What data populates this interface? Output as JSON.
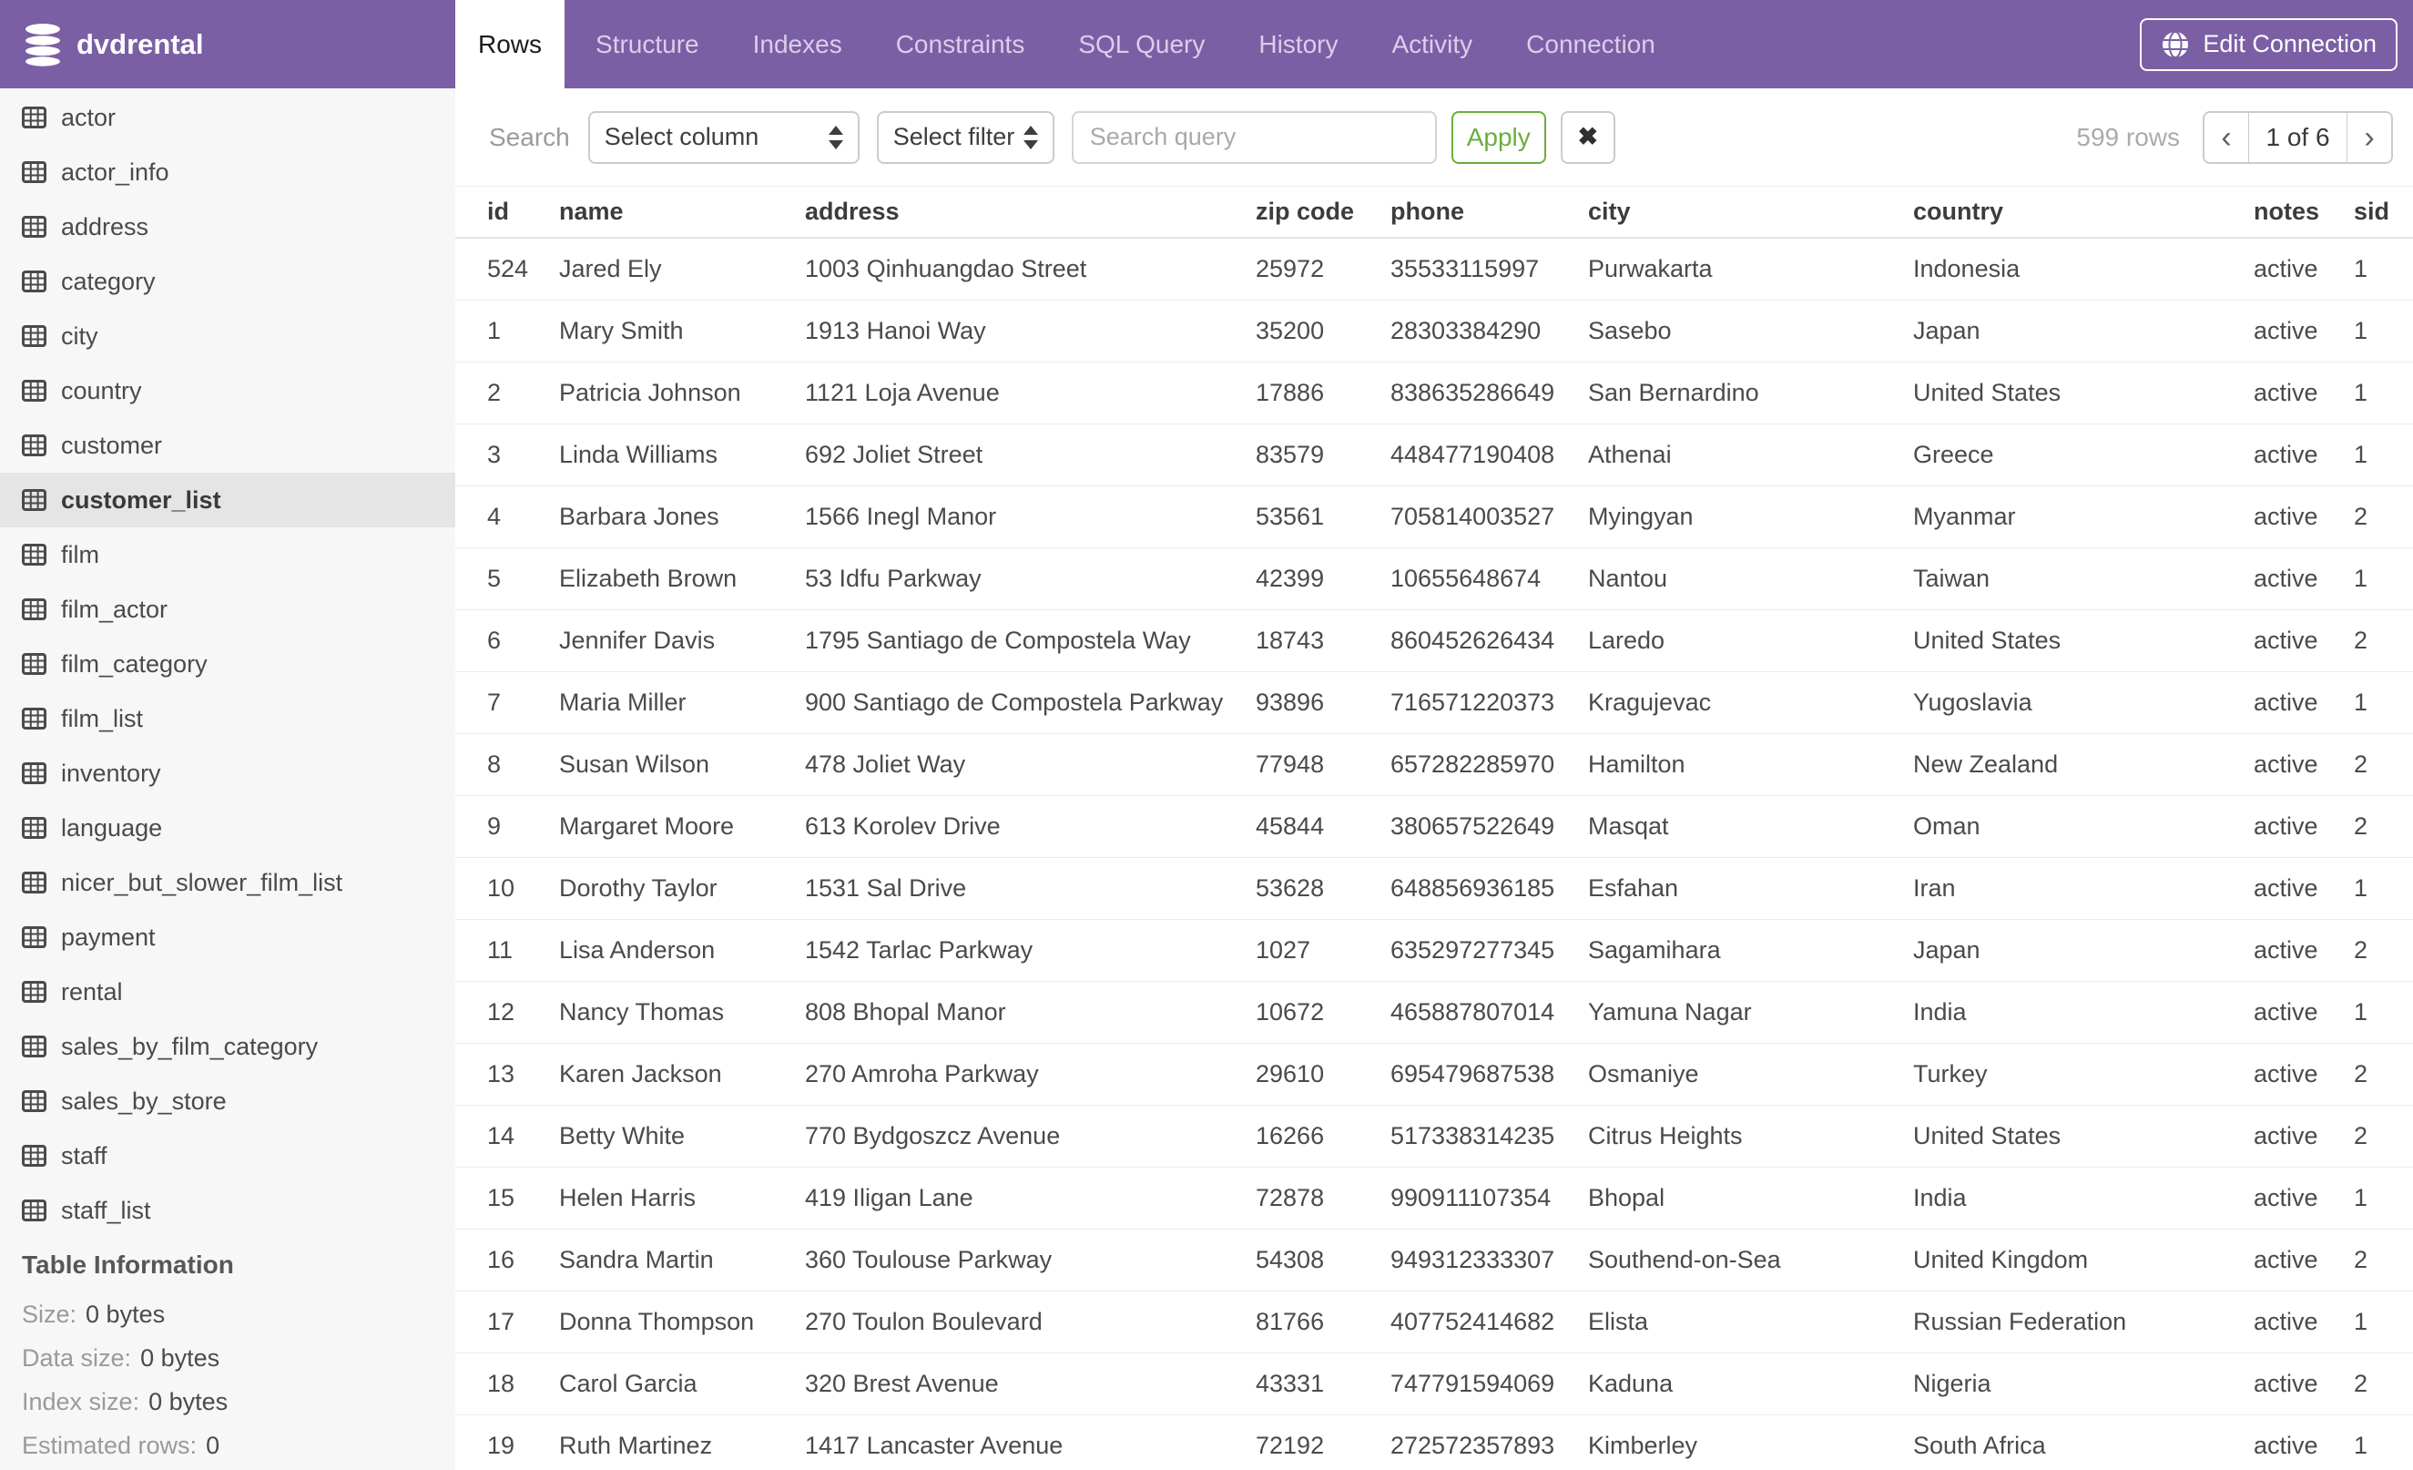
{
  "header": {
    "database_name": "dvdrental",
    "tabs": [
      {
        "label": "Rows",
        "active": true
      },
      {
        "label": "Structure"
      },
      {
        "label": "Indexes"
      },
      {
        "label": "Constraints"
      },
      {
        "label": "SQL Query"
      },
      {
        "label": "History"
      },
      {
        "label": "Activity"
      },
      {
        "label": "Connection"
      }
    ],
    "edit_connection_label": "Edit Connection"
  },
  "sidebar": {
    "tables": [
      {
        "label": "actor"
      },
      {
        "label": "actor_info"
      },
      {
        "label": "address"
      },
      {
        "label": "category"
      },
      {
        "label": "city"
      },
      {
        "label": "country"
      },
      {
        "label": "customer"
      },
      {
        "label": "customer_list",
        "active": true
      },
      {
        "label": "film"
      },
      {
        "label": "film_actor"
      },
      {
        "label": "film_category"
      },
      {
        "label": "film_list"
      },
      {
        "label": "inventory"
      },
      {
        "label": "language"
      },
      {
        "label": "nicer_but_slower_film_list"
      },
      {
        "label": "payment"
      },
      {
        "label": "rental"
      },
      {
        "label": "sales_by_film_category"
      },
      {
        "label": "sales_by_store"
      },
      {
        "label": "staff"
      },
      {
        "label": "staff_list"
      }
    ],
    "table_information": {
      "title": "Table Information",
      "fields": [
        {
          "label": "Size:",
          "value": "0 bytes"
        },
        {
          "label": "Data size:",
          "value": "0 bytes"
        },
        {
          "label": "Index size:",
          "value": "0 bytes"
        },
        {
          "label": "Estimated rows:",
          "value": "0"
        }
      ]
    }
  },
  "toolbar": {
    "search_label": "Search",
    "column_select_value": "Select column",
    "filter_select_value": "Select filter",
    "query_placeholder": "Search query",
    "apply_label": "Apply",
    "clear_icon": "✖",
    "rows_count": "599 rows",
    "pagination": {
      "prev": "‹",
      "current": "1 of 6",
      "next": "›"
    }
  },
  "table": {
    "columns": [
      "id",
      "name",
      "address",
      "zip code",
      "phone",
      "city",
      "country",
      "notes",
      "sid"
    ],
    "rows": [
      {
        "id": "524",
        "name": "Jared Ely",
        "address": "1003 Qinhuangdao Street",
        "zip": "25972",
        "phone": "35533115997",
        "city": "Purwakarta",
        "country": "Indonesia",
        "notes": "active",
        "sid": "1"
      },
      {
        "id": "1",
        "name": "Mary Smith",
        "address": "1913 Hanoi Way",
        "zip": "35200",
        "phone": "28303384290",
        "city": "Sasebo",
        "country": "Japan",
        "notes": "active",
        "sid": "1"
      },
      {
        "id": "2",
        "name": "Patricia Johnson",
        "address": "1121 Loja Avenue",
        "zip": "17886",
        "phone": "838635286649",
        "city": "San Bernardino",
        "country": "United States",
        "notes": "active",
        "sid": "1"
      },
      {
        "id": "3",
        "name": "Linda Williams",
        "address": "692 Joliet Street",
        "zip": "83579",
        "phone": "448477190408",
        "city": "Athenai",
        "country": "Greece",
        "notes": "active",
        "sid": "1"
      },
      {
        "id": "4",
        "name": "Barbara Jones",
        "address": "1566 Inegl Manor",
        "zip": "53561",
        "phone": "705814003527",
        "city": "Myingyan",
        "country": "Myanmar",
        "notes": "active",
        "sid": "2"
      },
      {
        "id": "5",
        "name": "Elizabeth Brown",
        "address": "53 Idfu Parkway",
        "zip": "42399",
        "phone": "10655648674",
        "city": "Nantou",
        "country": "Taiwan",
        "notes": "active",
        "sid": "1"
      },
      {
        "id": "6",
        "name": "Jennifer Davis",
        "address": "1795 Santiago de Compostela Way",
        "zip": "18743",
        "phone": "860452626434",
        "city": "Laredo",
        "country": "United States",
        "notes": "active",
        "sid": "2"
      },
      {
        "id": "7",
        "name": "Maria Miller",
        "address": "900 Santiago de Compostela Parkway",
        "zip": "93896",
        "phone": "716571220373",
        "city": "Kragujevac",
        "country": "Yugoslavia",
        "notes": "active",
        "sid": "1"
      },
      {
        "id": "8",
        "name": "Susan Wilson",
        "address": "478 Joliet Way",
        "zip": "77948",
        "phone": "657282285970",
        "city": "Hamilton",
        "country": "New Zealand",
        "notes": "active",
        "sid": "2"
      },
      {
        "id": "9",
        "name": "Margaret Moore",
        "address": "613 Korolev Drive",
        "zip": "45844",
        "phone": "380657522649",
        "city": "Masqat",
        "country": "Oman",
        "notes": "active",
        "sid": "2"
      },
      {
        "id": "10",
        "name": "Dorothy Taylor",
        "address": "1531 Sal Drive",
        "zip": "53628",
        "phone": "648856936185",
        "city": "Esfahan",
        "country": "Iran",
        "notes": "active",
        "sid": "1"
      },
      {
        "id": "11",
        "name": "Lisa Anderson",
        "address": "1542 Tarlac Parkway",
        "zip": "1027",
        "phone": "635297277345",
        "city": "Sagamihara",
        "country": "Japan",
        "notes": "active",
        "sid": "2"
      },
      {
        "id": "12",
        "name": "Nancy Thomas",
        "address": "808 Bhopal Manor",
        "zip": "10672",
        "phone": "465887807014",
        "city": "Yamuna Nagar",
        "country": "India",
        "notes": "active",
        "sid": "1"
      },
      {
        "id": "13",
        "name": "Karen Jackson",
        "address": "270 Amroha Parkway",
        "zip": "29610",
        "phone": "695479687538",
        "city": "Osmaniye",
        "country": "Turkey",
        "notes": "active",
        "sid": "2"
      },
      {
        "id": "14",
        "name": "Betty White",
        "address": "770 Bydgoszcz Avenue",
        "zip": "16266",
        "phone": "517338314235",
        "city": "Citrus Heights",
        "country": "United States",
        "notes": "active",
        "sid": "2"
      },
      {
        "id": "15",
        "name": "Helen Harris",
        "address": "419 Iligan Lane",
        "zip": "72878",
        "phone": "990911107354",
        "city": "Bhopal",
        "country": "India",
        "notes": "active",
        "sid": "1"
      },
      {
        "id": "16",
        "name": "Sandra Martin",
        "address": "360 Toulouse Parkway",
        "zip": "54308",
        "phone": "949312333307",
        "city": "Southend-on-Sea",
        "country": "United Kingdom",
        "notes": "active",
        "sid": "2"
      },
      {
        "id": "17",
        "name": "Donna Thompson",
        "address": "270 Toulon Boulevard",
        "zip": "81766",
        "phone": "407752414682",
        "city": "Elista",
        "country": "Russian Federation",
        "notes": "active",
        "sid": "1"
      },
      {
        "id": "18",
        "name": "Carol Garcia",
        "address": "320 Brest Avenue",
        "zip": "43331",
        "phone": "747791594069",
        "city": "Kaduna",
        "country": "Nigeria",
        "notes": "active",
        "sid": "2"
      },
      {
        "id": "19",
        "name": "Ruth Martinez",
        "address": "1417 Lancaster Avenue",
        "zip": "72192",
        "phone": "272572357893",
        "city": "Kimberley",
        "country": "South Africa",
        "notes": "active",
        "sid": "1"
      }
    ]
  },
  "colors": {
    "header_purple": "#7b5fa5",
    "inactive_tab_text": "#d9cfe9",
    "apply_green": "#6aae3d",
    "sidebar_bg": "#f7f7f7",
    "sidebar_selected_bg": "#e5e5e5",
    "row_border": "#ececec"
  }
}
